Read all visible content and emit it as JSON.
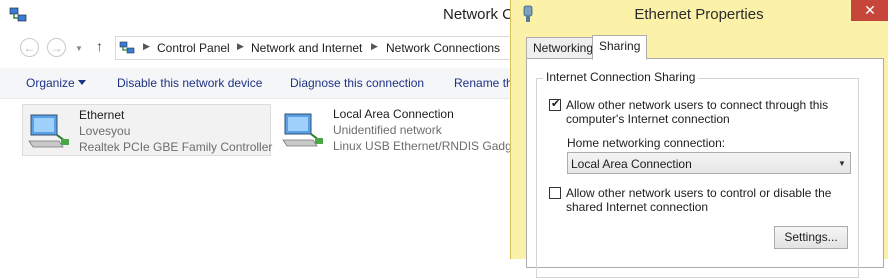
{
  "explorer": {
    "title": "Network C",
    "breadcrumb": [
      "Control Panel",
      "Network and Internet",
      "Network Connections"
    ],
    "commands": {
      "organize": "Organize",
      "disable": "Disable this network device",
      "diagnose": "Diagnose this connection",
      "rename": "Rename th"
    },
    "connections": [
      {
        "name": "Ethernet",
        "network": "Lovesyou",
        "adapter": "Realtek PCIe GBE Family Controller",
        "selected": true
      },
      {
        "name": "Local Area Connection",
        "network": "Unidentified network",
        "adapter": "Linux USB Ethernet/RNDIS Gadget",
        "selected": false
      }
    ],
    "icons": {
      "back": "back-arrow-icon",
      "forward": "forward-arrow-icon",
      "up": "up-arrow-icon",
      "organize_caret": "chevron-down-icon"
    }
  },
  "dialog": {
    "title": "Ethernet Properties",
    "close_glyph": "✕",
    "tabs": [
      "Networking",
      "Sharing"
    ],
    "active_tab": "Sharing",
    "group_title": "Internet Connection Sharing",
    "allow_connect_line1": "Allow other network users to connect through this",
    "allow_connect_line2": "computer's Internet connection",
    "allow_connect_checked": true,
    "check_glyph": "✔",
    "home_label": "Home networking connection:",
    "home_value": "Local Area Connection",
    "allow_control_line1": "Allow other network users to control or disable the",
    "allow_control_line2": "shared Internet connection",
    "allow_control_checked": false,
    "settings_button": "Settings...",
    "colors": {
      "titlebar": "#fbf1a8",
      "close": "#c7463c"
    }
  }
}
